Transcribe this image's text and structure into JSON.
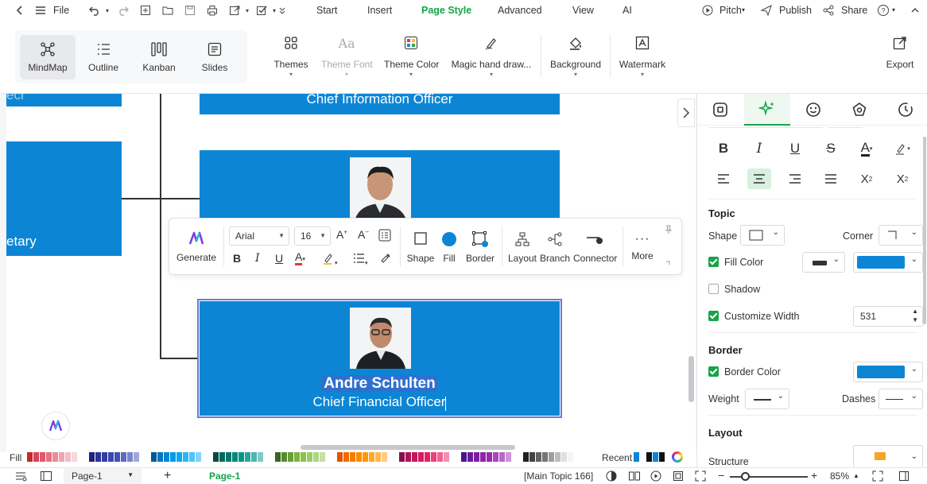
{
  "menu": {
    "file": "File",
    "tabs": [
      "Start",
      "Insert",
      "Page Style",
      "Advanced",
      "View",
      "AI"
    ],
    "pitch": "Pitch",
    "publish": "Publish",
    "share": "Share"
  },
  "ribbon": {
    "views": [
      "MindMap",
      "Outline",
      "Kanban",
      "Slides"
    ],
    "themes": "Themes",
    "theme_font": "Theme Font",
    "theme_color": "Theme Color",
    "magic": "Magic hand draw...",
    "background": "Background",
    "watermark": "Watermark",
    "export": "Export"
  },
  "canvas": {
    "node_top_text": "Chief Information Officer",
    "node_left_text": "etary",
    "node_left_top_text": "ecr",
    "selected_name": "Andre Schulten",
    "selected_title": "Chief Financial Officer"
  },
  "float_toolbar": {
    "generate": "Generate",
    "font": "Arial",
    "size": "16",
    "shape": "Shape",
    "fill": "Fill",
    "border": "Border",
    "layout": "Layout",
    "branch": "Branch",
    "connector": "Connector",
    "more": "More"
  },
  "panel": {
    "topic": "Topic",
    "shape": "Shape",
    "corner": "Corner",
    "fill_color": "Fill Color",
    "shadow": "Shadow",
    "customize_width": "Customize Width",
    "width_value": "531",
    "border": "Border",
    "border_color": "Border Color",
    "weight": "Weight",
    "dashes": "Dashes",
    "layout": "Layout",
    "structure": "Structure"
  },
  "colors": {
    "node_blue": "#0c86d4",
    "accent_green": "#17a34a"
  },
  "colorbar": {
    "fill": "Fill",
    "recent": "Recent"
  },
  "status": {
    "page_select": "Page-1",
    "page_tab": "Page-1",
    "topic_info": "[Main Topic 166]",
    "zoom": "85%"
  }
}
